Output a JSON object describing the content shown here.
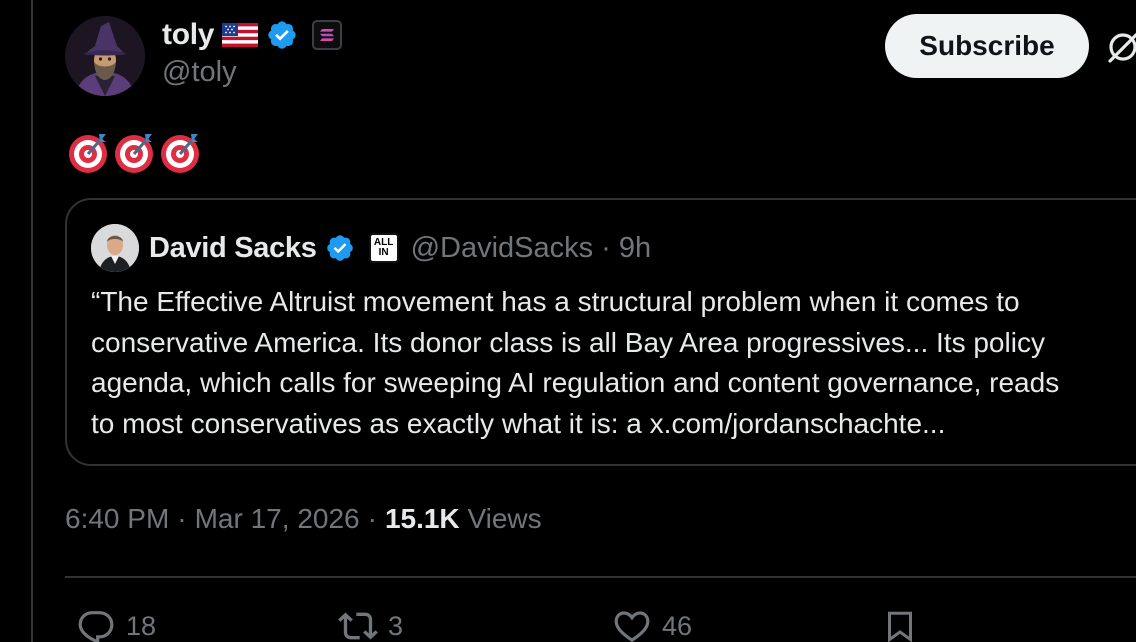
{
  "author": {
    "display_name": "toly",
    "handle": "@toly",
    "flag_icon": "us-flag-icon",
    "verified_color": "#1d9bf0",
    "affiliate_badge_icon": "solana-badge-icon"
  },
  "header": {
    "subscribe_label": "Subscribe",
    "grok_icon": "grok-icon"
  },
  "post": {
    "emoji_text": "🎯🎯🎯"
  },
  "quote": {
    "display_name": "David Sacks",
    "handle": "@DavidSacks",
    "separator": "·",
    "time": "9h",
    "affiliate_badge_lines": [
      "ALL",
      "IN"
    ],
    "text_lines": [
      "“The Effective Altruist movement has a structural problem when it comes to",
      "conservative America. Its donor class is all Bay Area progressives... Its policy",
      "agenda, which calls for sweeping AI regulation and content governance, reads",
      "to most conservatives as exactly what it is: a x.com/jordanschachte..."
    ]
  },
  "meta": {
    "time": "6:40 PM",
    "sep1": "·",
    "date": "Mar 17, 2026",
    "sep2": "·",
    "views_count": "15.1K",
    "views_label": "Views"
  },
  "actions": {
    "replies": "18",
    "reposts": "3",
    "likes": "46"
  },
  "colors": {
    "background": "#000000",
    "text_primary": "#e7e9ea",
    "text_secondary": "#71767b",
    "border": "#2f3336",
    "accent": "#1d9bf0"
  }
}
